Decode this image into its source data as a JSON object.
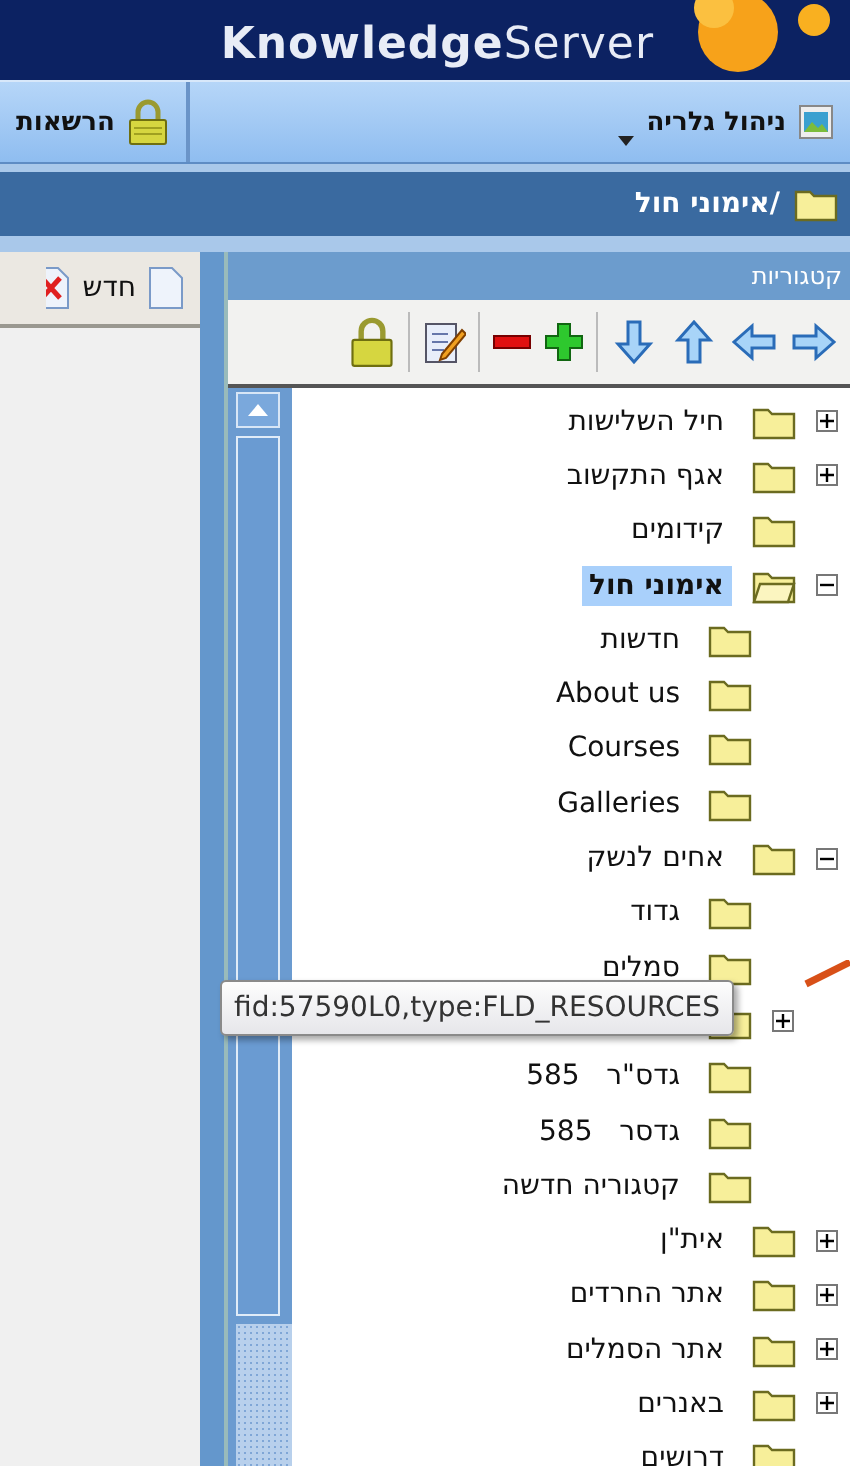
{
  "header": {
    "logo": "**Knowledge**Server"
  },
  "menu_bar": {
    "items": [
      {
        "label": "ניהול גלריה",
        "kind": "dropdown"
      },
      {
        "label": "הרשאות",
        "kind": "lock"
      }
    ]
  },
  "breadcrumb": {
    "path": "/אימוני חול"
  },
  "left_pane": {
    "toolbar": [
      {
        "label": "חדש",
        "kind": "new"
      },
      {
        "kind": "delete"
      }
    ]
  },
  "categories": {
    "title": "קטגוריות",
    "tooltip": "fid:57590L0,type:FLD_RESOURCES",
    "tree": [
      {
        "label": "חיל השלישות",
        "selected": false,
        "expanded": false
      },
      {
        "label": "אגף התקשוב",
        "selected": false,
        "expanded": false
      },
      {
        "label": "קידומים",
        "selected": false
      },
      {
        "label": "אימוני חול",
        "selected": true,
        "expanded": true,
        "children": [
          {
            "label": "חדשות",
            "selected": false
          },
          {
            "label": "About us",
            "selected": false
          },
          {
            "label": "Courses",
            "selected": false
          },
          {
            "label": "Galleries",
            "selected": false
          }
        ]
      },
      {
        "label": "אחים לנשק",
        "selected": false,
        "expanded": true,
        "children": [
          {
            "label": "גדוד",
            "selected": false
          },
          {
            "label": "סמלים",
            "selected": false
          },
          {
            "selected": false,
            "expanded": false
          },
          {
            "label": "גדס\"ר   585",
            "selected": false
          },
          {
            "label": "גדסר   585",
            "selected": false
          },
          {
            "label": "קטגוריה חדשה",
            "selected": false
          }
        ]
      },
      {
        "label": "אית\"ן",
        "selected": false,
        "expanded": false
      },
      {
        "label": "אתר החרדים",
        "selected": false,
        "expanded": false
      },
      {
        "label": "אתר הסמלים",
        "selected": false,
        "expanded": false
      },
      {
        "label": "באנרים",
        "selected": false,
        "expanded": false
      },
      {
        "label": "דרושים",
        "selected": false
      }
    ]
  }
}
